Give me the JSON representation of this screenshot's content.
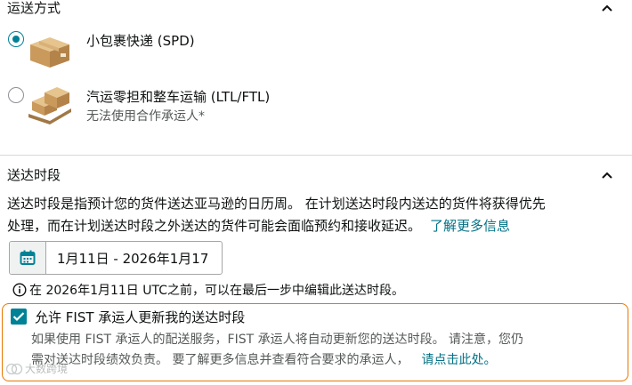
{
  "shipping_method": {
    "title": "运送方式",
    "options": [
      {
        "label": "小包裹快递 (SPD)",
        "sublabel": "",
        "selected": true,
        "icon": "small-parcel-box-icon"
      },
      {
        "label": "汽运零担和整车运输 (LTL/FTL)",
        "sublabel": "无法使用合作承运人*",
        "selected": false,
        "icon": "pallet-boxes-icon"
      }
    ]
  },
  "delivery_window": {
    "title": "送达时段",
    "description_line1": "送达时段是指预计您的货件送达亚马逊的日历周。 在计划送达时段内送达的货件将获得优先",
    "description_line2": "处理，而在计划送达时段之外送达的货件可能会面临预约和接收延迟。",
    "learn_more_link": "了解更多信息",
    "date_range": "1月11日 - 2026年1月17",
    "info_text": "在 2026年1月11日 UTC之前，可以在最后一步中编辑此送达时段。"
  },
  "fist": {
    "checkbox_label": "允许 FIST 承运人更新我的送达时段",
    "checked": true,
    "description_line1": "如果使用 FIST 承运人的配送服务，FIST 承运人将自动更新您的送达时段。 请注意，您仍",
    "description_line2": "需对送达时段绩效负责。 要了解更多信息并查看符合要求的承运人，",
    "click_here_link": "请点击此处。"
  },
  "watermark": {
    "text": "大数跨境"
  },
  "colors": {
    "accent": "#008296",
    "link": "#007185",
    "highlight_border": "#e77600"
  }
}
